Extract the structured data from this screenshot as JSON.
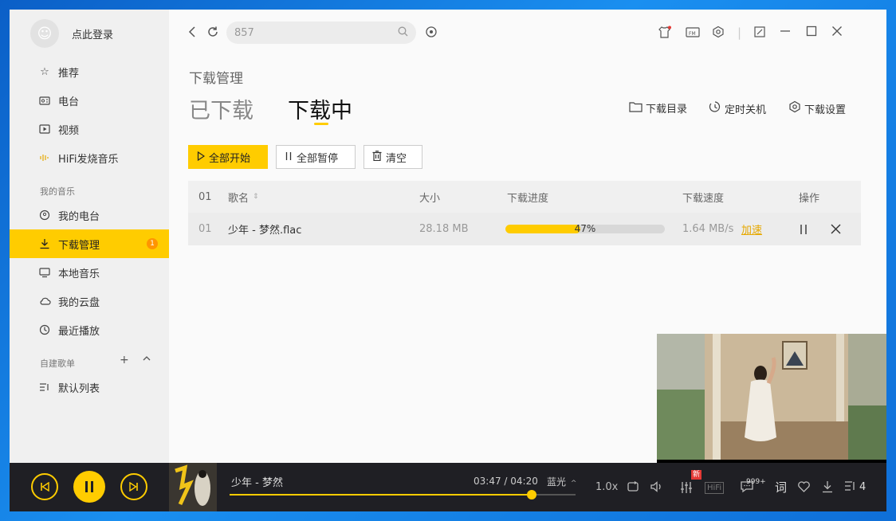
{
  "sidebar": {
    "login_label": "点此登录",
    "items": [
      {
        "label": "推荐",
        "icon": "star-icon"
      },
      {
        "label": "电台",
        "icon": "radio-icon"
      },
      {
        "label": "视频",
        "icon": "video-icon"
      },
      {
        "label": "HiFi发烧音乐",
        "icon": "soundwave-icon"
      }
    ],
    "my_music_label": "我的音乐",
    "my_items": [
      {
        "label": "我的电台",
        "icon": "podcast-icon"
      },
      {
        "label": "下载管理",
        "icon": "download-icon",
        "badge": "1",
        "active": true
      },
      {
        "label": "本地音乐",
        "icon": "monitor-icon"
      },
      {
        "label": "我的云盘",
        "icon": "cloud-icon"
      },
      {
        "label": "最近播放",
        "icon": "clock-icon"
      }
    ],
    "playlist_section_label": "自建歌单",
    "playlists": [
      {
        "label": "默认列表",
        "icon": "playlist-icon"
      }
    ]
  },
  "topbar": {
    "search_value": "857"
  },
  "page": {
    "small_title": "下载管理",
    "tabs": [
      "已下载",
      "下载中"
    ],
    "active_tab": "下载中",
    "links": {
      "download_dir": "下载目录",
      "timer_shutdown": "定时关机",
      "download_settings": "下载设置"
    },
    "buttons": {
      "start_all": "全部开始",
      "pause_all": "全部暂停",
      "clear": "清空"
    }
  },
  "table": {
    "headers": {
      "index": "01",
      "name": "歌名",
      "size": "大小",
      "progress": "下载进度",
      "speed": "下载速度",
      "ops": "操作"
    },
    "rows": [
      {
        "index": "01",
        "name": "少年 - 梦然.flac",
        "size": "28.18 MB",
        "progress": 0.47,
        "progress_text": "47%",
        "speed": "1.64 MB/s",
        "speedup": "加速"
      }
    ]
  },
  "player": {
    "song": "少年 - 梦然",
    "time": "03:47 / 04:20",
    "progress": 0.873,
    "quality": "蓝光",
    "rate": "1.0x",
    "hifi": "HiFi",
    "new_badge": "新",
    "comment_count": "999+",
    "lyric_label": "词",
    "queue_count": "4"
  },
  "colors": {
    "accent": "#ffcc00",
    "badge": "#ff9500",
    "player_bg": "#1f1f24"
  }
}
